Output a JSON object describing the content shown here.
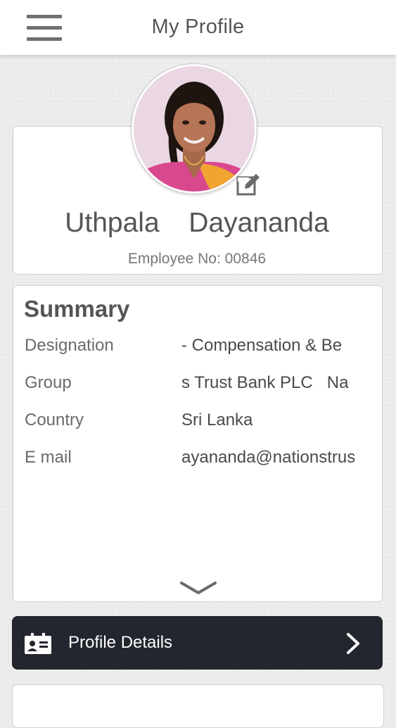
{
  "header": {
    "title": "My Profile",
    "menu_icon": "hamburger-menu-icon"
  },
  "profile": {
    "name": "Uthpala  Dayananda",
    "employee_no": "Employee No: 00846",
    "edit_icon": "edit-icon"
  },
  "summary": {
    "title": "Summary",
    "rows": [
      {
        "label": "Designation",
        "value": "- Compensation & Be"
      },
      {
        "label": "Group",
        "value": "s Trust Bank PLC   Na"
      },
      {
        "label": "Country",
        "value": "Sri Lanka"
      },
      {
        "label": "E mail",
        "value": "ayananda@nationstrus"
      }
    ],
    "expand_icon": "chevron-down-icon"
  },
  "menu": {
    "profile_details": {
      "label": "Profile Details",
      "icon": "id-card-icon",
      "arrow": "chevron-right-icon"
    }
  },
  "colors": {
    "header_bg": "#ffffff",
    "page_bg": "#ebebeb",
    "button_dark": "#23262e",
    "text": "#555555"
  }
}
